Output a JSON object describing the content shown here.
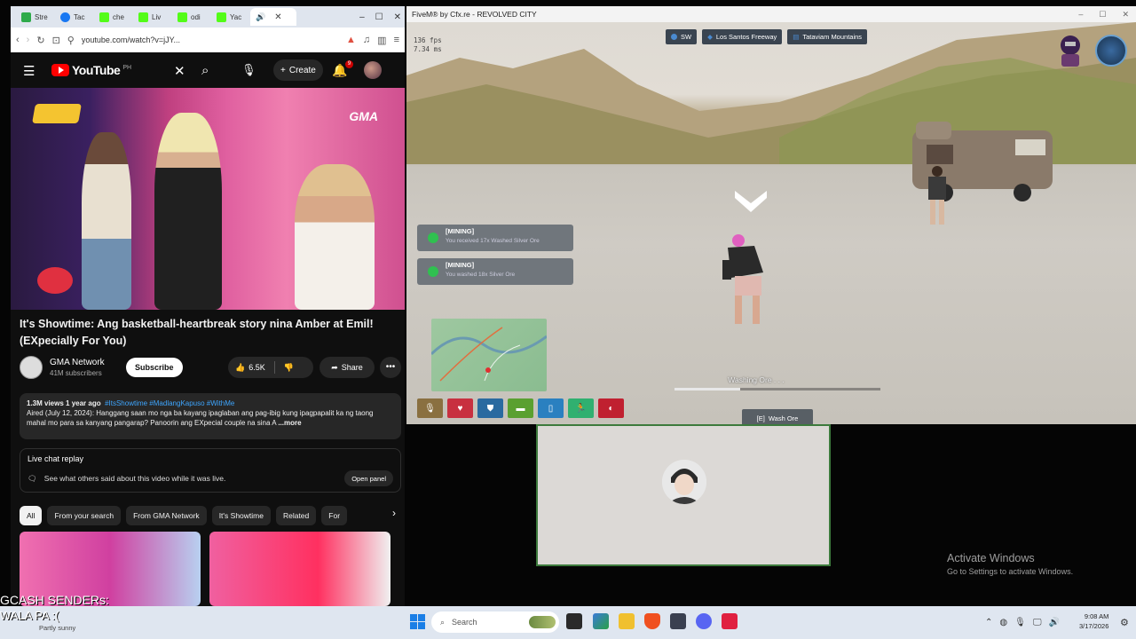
{
  "browser": {
    "tabs": [
      {
        "label": "Stre",
        "color": "#2eaa4a"
      },
      {
        "label": "Tac",
        "color": "#1877f2"
      },
      {
        "label": "che",
        "color": "#53fc18"
      },
      {
        "label": "Liv",
        "color": "#53fc18"
      },
      {
        "label": "odi",
        "color": "#53fc18"
      },
      {
        "label": "Yac",
        "color": "#53fc18"
      }
    ],
    "url": "youtube.com/watch?v=jJY...",
    "window_controls": [
      "–",
      "☐",
      "✕"
    ]
  },
  "youtube": {
    "logo_text": "YouTube",
    "logo_region": "PH",
    "create_label": "Create",
    "notification_count": "9",
    "video": {
      "title": "It's Showtime: Ang basketball-heartbreak story nina Amber at Emil! (EXpecially For You)",
      "channel": "GMA Network",
      "subscribers": "41M subscribers",
      "subscribe_label": "Subscribe",
      "likes": "6.5K",
      "share_label": "Share",
      "watermark": "GMA"
    },
    "description": {
      "meta": "1.3M views  1 year ago",
      "tags": "#ItsShowtime #MadlangKapuso #WithMe",
      "text": "Aired (July 12, 2024): Hanggang saan mo nga ba kayang ipaglaban ang pag-ibig kung ipagpapalit ka ng taong mahal mo para sa kanyang pangarap? Panoorin ang EXpecial couple na sina A",
      "more_label": "...more"
    },
    "live_chat": {
      "title": "Live chat replay",
      "text": "See what others said about this video while it was live.",
      "button": "Open panel"
    },
    "chips": [
      "All",
      "From your search",
      "From GMA Network",
      "It's Showtime",
      "Related",
      "For"
    ]
  },
  "fivem": {
    "title": "FiveM® by Cfx.re - REVOLVED CITY",
    "fps": "136 fps",
    "frametime": "7.34 ms",
    "location": {
      "direction": "SW",
      "street": "Los Santos Freeway",
      "area": "Tataviam Mountains"
    },
    "notifications": [
      {
        "title": "[MINING]",
        "body": "You received 17x Washed Silver Ore"
      },
      {
        "title": "[MINING]",
        "body": "You washed 18x Silver Ore"
      }
    ],
    "hotbar": [
      {
        "icon": "microphone-icon",
        "color": "#8a7040"
      },
      {
        "icon": "heart-icon",
        "color": "#c83040"
      },
      {
        "icon": "shield-icon",
        "color": "#2a6aa0"
      },
      {
        "icon": "food-icon",
        "color": "#5aa030"
      },
      {
        "icon": "water-icon",
        "color": "#2a80c0"
      },
      {
        "icon": "stamina-icon",
        "color": "#30b070"
      },
      {
        "icon": "stress-icon",
        "color": "#c02030"
      }
    ],
    "progress": {
      "label": "Washing Ore . . .",
      "fraction": 0.32
    },
    "action": {
      "key": "[E]",
      "label": "Wash Ore"
    }
  },
  "desktop": {
    "activate_title": "Activate Windows",
    "activate_sub": "Go to Settings to activate Windows.",
    "overlay_line1": "GCASH SENDERs:",
    "overlay_line2": "WALA PA :("
  },
  "taskbar": {
    "weather": "Partly sunny",
    "search_placeholder": "Search",
    "time": "9:08 AM",
    "date": "3/17/2026"
  }
}
